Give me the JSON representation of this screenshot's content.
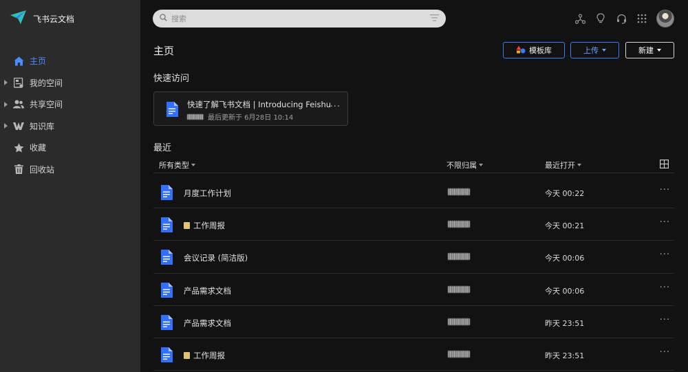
{
  "app": {
    "title": "飞书云文档"
  },
  "sidebar": {
    "items": [
      {
        "label": "主页",
        "icon": "home-icon",
        "active": true,
        "expandable": false
      },
      {
        "label": "我的空间",
        "icon": "my-space-icon",
        "active": false,
        "expandable": true
      },
      {
        "label": "共享空间",
        "icon": "shared-space-icon",
        "active": false,
        "expandable": true
      },
      {
        "label": "知识库",
        "icon": "wiki-icon",
        "active": false,
        "expandable": true
      },
      {
        "label": "收藏",
        "icon": "star-icon",
        "active": false,
        "expandable": false
      },
      {
        "label": "回收站",
        "icon": "trash-icon",
        "active": false,
        "expandable": false
      }
    ]
  },
  "search": {
    "placeholder": "搜索"
  },
  "header": {
    "title": "主页",
    "template_label": "模板库",
    "upload_label": "上传",
    "new_label": "新建"
  },
  "quick_access": {
    "title": "快速访问",
    "card": {
      "title": "快速了解飞书文档 | Introducing Feishu ...",
      "meta": "最后更新于 6月28日 10:14"
    }
  },
  "recent": {
    "title": "最近",
    "columns": {
      "type": "所有类型",
      "owner": "不限归属",
      "opened": "最近打开"
    },
    "rows": [
      {
        "name": "月度工作计划",
        "tag": false,
        "time": "今天 00:22"
      },
      {
        "name": "工作周报",
        "tag": true,
        "time": "今天 00:21"
      },
      {
        "name": "会议记录 (简洁版)",
        "tag": false,
        "time": "今天 00:06"
      },
      {
        "name": "产品需求文档",
        "tag": false,
        "time": "今天 00:06"
      },
      {
        "name": "产品需求文档",
        "tag": false,
        "time": "昨天 23:51"
      },
      {
        "name": "工作周报",
        "tag": true,
        "time": "昨天 23:51"
      }
    ]
  },
  "colors": {
    "accent": "#3c7bf6",
    "active_nav": "#4d8dff",
    "doc_icon": "#3370ff",
    "sidebar_bg": "#2b2b2b",
    "main_bg": "#121212"
  }
}
